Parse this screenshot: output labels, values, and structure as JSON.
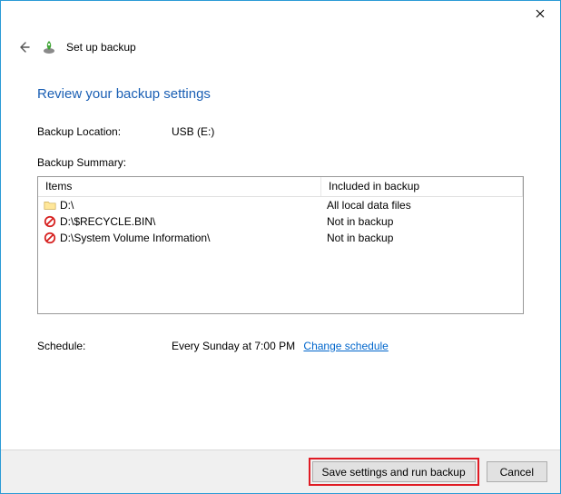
{
  "window": {
    "wizard_title": "Set up backup",
    "page_heading": "Review your backup settings"
  },
  "fields": {
    "backup_location_label": "Backup Location:",
    "backup_location_value": "USB (E:)",
    "backup_summary_label": "Backup Summary:",
    "schedule_label": "Schedule:",
    "schedule_value": "Every Sunday at 7:00 PM",
    "change_schedule_link": "Change schedule"
  },
  "table": {
    "col_items": "Items",
    "col_included": "Included in backup",
    "rows": [
      {
        "icon": "folder",
        "name": "D:\\",
        "included": "All local data files"
      },
      {
        "icon": "exclude",
        "name": "D:\\$RECYCLE.BIN\\",
        "included": "Not in backup"
      },
      {
        "icon": "exclude",
        "name": "D:\\System Volume Information\\",
        "included": "Not in backup"
      }
    ]
  },
  "buttons": {
    "primary": "Save settings and run backup",
    "cancel": "Cancel"
  }
}
